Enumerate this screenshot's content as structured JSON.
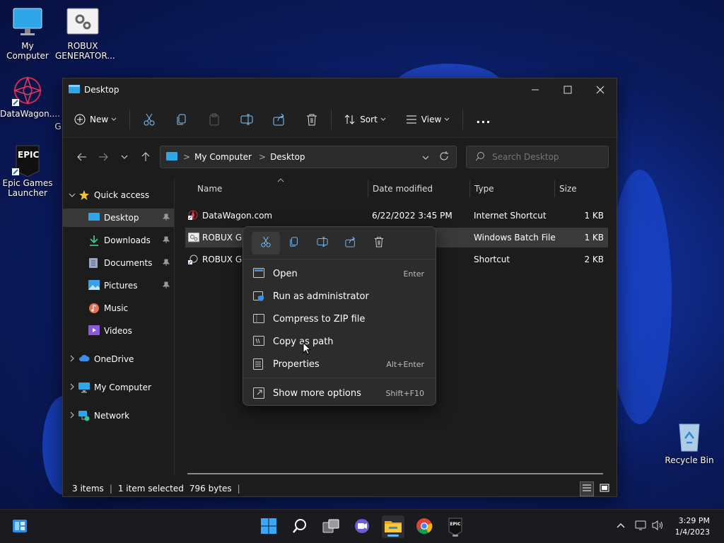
{
  "desktop": {
    "icons": [
      {
        "label": "My Computer"
      },
      {
        "label": "ROBUX GENERATOR..."
      },
      {
        "label": "DataWagon...."
      },
      {
        "label": "G"
      },
      {
        "label": "Epic Games Launcher"
      },
      {
        "label": "Recycle Bin"
      }
    ],
    "epic_logo_text": "EPIC"
  },
  "window": {
    "title": "Desktop",
    "command_bar": {
      "new_label": "New",
      "sort_label": "Sort",
      "view_label": "View",
      "more_label": "..."
    },
    "address": {
      "crumbs": [
        "My Computer",
        "Desktop"
      ],
      "separator": ">"
    },
    "search": {
      "placeholder": "Search Desktop"
    },
    "nav": {
      "quick_access": "Quick access",
      "items": [
        {
          "label": "Desktop"
        },
        {
          "label": "Downloads"
        },
        {
          "label": "Documents"
        },
        {
          "label": "Pictures"
        },
        {
          "label": "Music"
        },
        {
          "label": "Videos"
        }
      ],
      "onedrive": "OneDrive",
      "my_computer": "My Computer",
      "network": "Network"
    },
    "columns": {
      "name": "Name",
      "date": "Date modified",
      "type": "Type",
      "size": "Size"
    },
    "files": [
      {
        "name": "DataWagon.com",
        "date": "6/22/2022 3:45 PM",
        "type": "Internet Shortcut",
        "size": "1 KB"
      },
      {
        "name": "ROBUX GEI",
        "date": "",
        "type": "Windows Batch File",
        "size": "1 KB"
      },
      {
        "name": "ROBUX GEI",
        "date": "",
        "type": "Shortcut",
        "size": "2 KB"
      }
    ],
    "status": {
      "items": "3 items",
      "selected": "1 item selected",
      "bytes": "796 bytes"
    }
  },
  "context_menu": {
    "items": [
      {
        "label": "Open",
        "shortcut": "Enter"
      },
      {
        "label": "Run as administrator",
        "shortcut": ""
      },
      {
        "label": "Compress to ZIP file",
        "shortcut": ""
      },
      {
        "label": "Copy as path",
        "shortcut": ""
      },
      {
        "label": "Properties",
        "shortcut": "Alt+Enter"
      },
      {
        "label": "Show more options",
        "shortcut": "Shift+F10"
      }
    ]
  },
  "taskbar": {
    "time": "3:29 PM",
    "date": "1/4/2023",
    "epic_text": "EPIC"
  },
  "colors": {
    "accent": "#60c0ff",
    "folder": "#f0c040",
    "selection": "#3a3a3a"
  }
}
